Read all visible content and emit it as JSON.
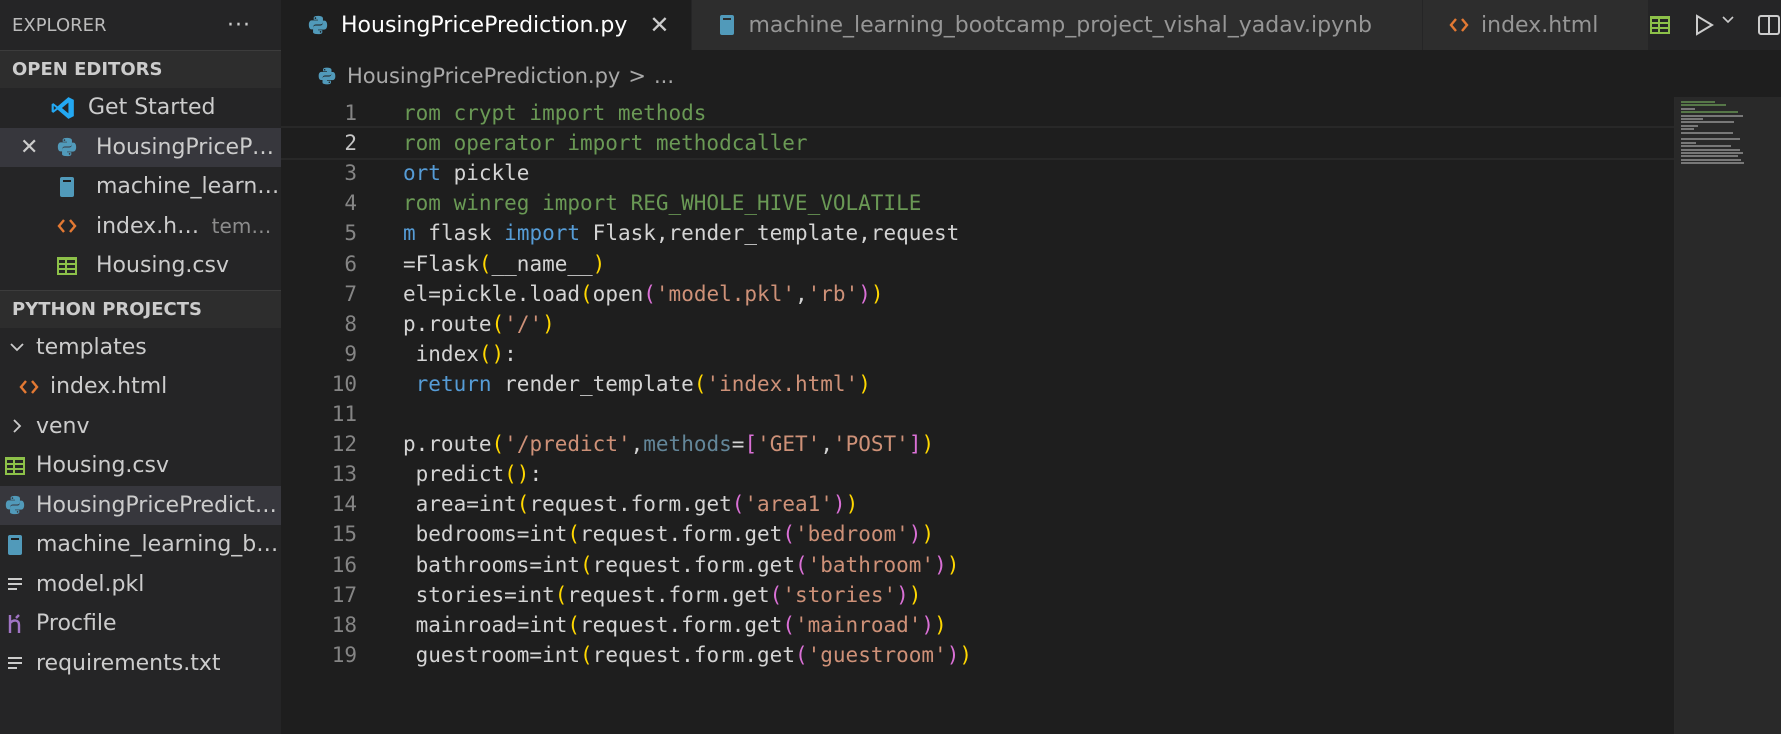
{
  "sidebar": {
    "title": "EXPLORER",
    "more": "···",
    "open_editors": {
      "title": "OPEN EDITORS",
      "items": [
        {
          "label": "Get Started",
          "icon": "vscode-icon"
        },
        {
          "label": "HousingPricePre...",
          "icon": "python-icon",
          "close": "✕"
        },
        {
          "label": "machine_learnin...",
          "icon": "notebook-icon"
        },
        {
          "label": "index.html",
          "desc": "templ...",
          "icon": "html-icon"
        },
        {
          "label": "Housing.csv",
          "icon": "csv-icon"
        }
      ]
    },
    "project": {
      "title": "PYTHON PROJECTS",
      "items": [
        {
          "label": "templates",
          "icon": "chevron-down-icon"
        },
        {
          "label": "index.html",
          "icon": "html-icon"
        },
        {
          "label": "venv",
          "icon": "chevron-right-icon"
        },
        {
          "label": "Housing.csv",
          "icon": "csv-icon"
        },
        {
          "label": "HousingPricePredictio...",
          "icon": "python-icon"
        },
        {
          "label": "machine_learning_bo...",
          "icon": "notebook-icon"
        },
        {
          "label": "model.pkl",
          "icon": "file-lines-icon"
        },
        {
          "label": "Procfile",
          "icon": "heroku-icon"
        },
        {
          "label": "requirements.txt",
          "icon": "file-lines-icon"
        }
      ]
    }
  },
  "tabs": [
    {
      "label": "HousingPricePrediction.py",
      "icon": "python-icon",
      "close": "✕"
    },
    {
      "label": "machine_learning_bootcamp_project_vishal_yadav.ipynb",
      "icon": "notebook-icon"
    },
    {
      "label": "index.html",
      "icon": "html-icon"
    }
  ],
  "breadcrumb": {
    "file": "HousingPricePrediction.py",
    "sep": ">",
    "rest": "..."
  },
  "editor": {
    "current_line": 2,
    "lines": [
      {
        "n": "1",
        "tokens": [
          {
            "t": "rom crypt import methods",
            "c": "tk-green"
          }
        ]
      },
      {
        "n": "2",
        "tokens": [
          {
            "t": "rom operator import methodcaller",
            "c": "tk-green"
          }
        ]
      },
      {
        "n": "3",
        "tokens": [
          {
            "t": "ort",
            "c": "tk-kw"
          },
          {
            "t": " pickle",
            "c": ""
          }
        ]
      },
      {
        "n": "4",
        "tokens": [
          {
            "t": "rom winreg import REG_WHOLE_HIVE_VOLATILE",
            "c": "tk-green"
          }
        ]
      },
      {
        "n": "5",
        "tokens": [
          {
            "t": "m",
            "c": "tk-kw"
          },
          {
            "t": " flask ",
            "c": ""
          },
          {
            "t": "import",
            "c": "tk-kw"
          },
          {
            "t": " Flask,render_template,request",
            "c": ""
          }
        ]
      },
      {
        "n": "6",
        "tokens": [
          {
            "t": "=Flask",
            "c": ""
          },
          {
            "t": "(",
            "c": "tk-par"
          },
          {
            "t": "__name__",
            "c": ""
          },
          {
            "t": ")",
            "c": "tk-par"
          }
        ]
      },
      {
        "n": "7",
        "tokens": [
          {
            "t": "el=pickle.load",
            "c": ""
          },
          {
            "t": "(",
            "c": "tk-par"
          },
          {
            "t": "open",
            "c": ""
          },
          {
            "t": "(",
            "c": "tk-par2"
          },
          {
            "t": "'model.pkl'",
            "c": "tk-str"
          },
          {
            "t": ",",
            "c": ""
          },
          {
            "t": "'rb'",
            "c": "tk-str"
          },
          {
            "t": ")",
            "c": "tk-par2"
          },
          {
            "t": ")",
            "c": "tk-par"
          }
        ]
      },
      {
        "n": "8",
        "tokens": [
          {
            "t": "p.route",
            "c": ""
          },
          {
            "t": "(",
            "c": "tk-par"
          },
          {
            "t": "'/'",
            "c": "tk-str"
          },
          {
            "t": ")",
            "c": "tk-par"
          }
        ]
      },
      {
        "n": "9",
        "tokens": [
          {
            "t": " index",
            "c": ""
          },
          {
            "t": "()",
            "c": "tk-par"
          },
          {
            "t": ":",
            "c": ""
          }
        ]
      },
      {
        "n": "10",
        "tokens": [
          {
            "t": " ",
            "c": ""
          },
          {
            "t": "return",
            "c": "tk-kw"
          },
          {
            "t": " render_template",
            "c": ""
          },
          {
            "t": "(",
            "c": "tk-par"
          },
          {
            "t": "'index.html'",
            "c": "tk-str"
          },
          {
            "t": ")",
            "c": "tk-par"
          }
        ]
      },
      {
        "n": "11",
        "tokens": []
      },
      {
        "n": "12",
        "tokens": [
          {
            "t": "p.route",
            "c": ""
          },
          {
            "t": "(",
            "c": "tk-par"
          },
          {
            "t": "'/predict'",
            "c": "tk-str"
          },
          {
            "t": ",",
            "c": ""
          },
          {
            "t": "methods",
            "c": "tk-param"
          },
          {
            "t": "=",
            "c": ""
          },
          {
            "t": "[",
            "c": "tk-par2"
          },
          {
            "t": "'GET'",
            "c": "tk-str"
          },
          {
            "t": ",",
            "c": ""
          },
          {
            "t": "'POST'",
            "c": "tk-str"
          },
          {
            "t": "]",
            "c": "tk-par2"
          },
          {
            "t": ")",
            "c": "tk-par"
          }
        ]
      },
      {
        "n": "13",
        "tokens": [
          {
            "t": " predict",
            "c": ""
          },
          {
            "t": "()",
            "c": "tk-par"
          },
          {
            "t": ":",
            "c": ""
          }
        ]
      },
      {
        "n": "14",
        "tokens": [
          {
            "t": " area=int",
            "c": ""
          },
          {
            "t": "(",
            "c": "tk-par"
          },
          {
            "t": "request.form.get",
            "c": ""
          },
          {
            "t": "(",
            "c": "tk-par2"
          },
          {
            "t": "'area1'",
            "c": "tk-str"
          },
          {
            "t": ")",
            "c": "tk-par2"
          },
          {
            "t": ")",
            "c": "tk-par"
          }
        ]
      },
      {
        "n": "15",
        "tokens": [
          {
            "t": " bedrooms=int",
            "c": ""
          },
          {
            "t": "(",
            "c": "tk-par"
          },
          {
            "t": "request.form.get",
            "c": ""
          },
          {
            "t": "(",
            "c": "tk-par2"
          },
          {
            "t": "'bedroom'",
            "c": "tk-str"
          },
          {
            "t": ")",
            "c": "tk-par2"
          },
          {
            "t": ")",
            "c": "tk-par"
          }
        ]
      },
      {
        "n": "16",
        "tokens": [
          {
            "t": " bathrooms=int",
            "c": ""
          },
          {
            "t": "(",
            "c": "tk-par"
          },
          {
            "t": "request.form.get",
            "c": ""
          },
          {
            "t": "(",
            "c": "tk-par2"
          },
          {
            "t": "'bathroom'",
            "c": "tk-str"
          },
          {
            "t": ")",
            "c": "tk-par2"
          },
          {
            "t": ")",
            "c": "tk-par"
          }
        ]
      },
      {
        "n": "17",
        "tokens": [
          {
            "t": " stories=int",
            "c": ""
          },
          {
            "t": "(",
            "c": "tk-par"
          },
          {
            "t": "request.form.get",
            "c": ""
          },
          {
            "t": "(",
            "c": "tk-par2"
          },
          {
            "t": "'stories'",
            "c": "tk-str"
          },
          {
            "t": ")",
            "c": "tk-par2"
          },
          {
            "t": ")",
            "c": "tk-par"
          }
        ]
      },
      {
        "n": "18",
        "tokens": [
          {
            "t": " mainroad=int",
            "c": ""
          },
          {
            "t": "(",
            "c": "tk-par"
          },
          {
            "t": "request.form.get",
            "c": ""
          },
          {
            "t": "(",
            "c": "tk-par2"
          },
          {
            "t": "'mainroad'",
            "c": "tk-str"
          },
          {
            "t": ")",
            "c": "tk-par2"
          },
          {
            "t": ")",
            "c": "tk-par"
          }
        ]
      },
      {
        "n": "19",
        "tokens": [
          {
            "t": " guestroom=int",
            "c": ""
          },
          {
            "t": "(",
            "c": "tk-par"
          },
          {
            "t": "request.form.get",
            "c": ""
          },
          {
            "t": "(",
            "c": "tk-par2"
          },
          {
            "t": "'guestroom'",
            "c": "tk-str"
          },
          {
            "t": ")",
            "c": "tk-par2"
          },
          {
            "t": ")",
            "c": "tk-par"
          }
        ]
      }
    ]
  }
}
